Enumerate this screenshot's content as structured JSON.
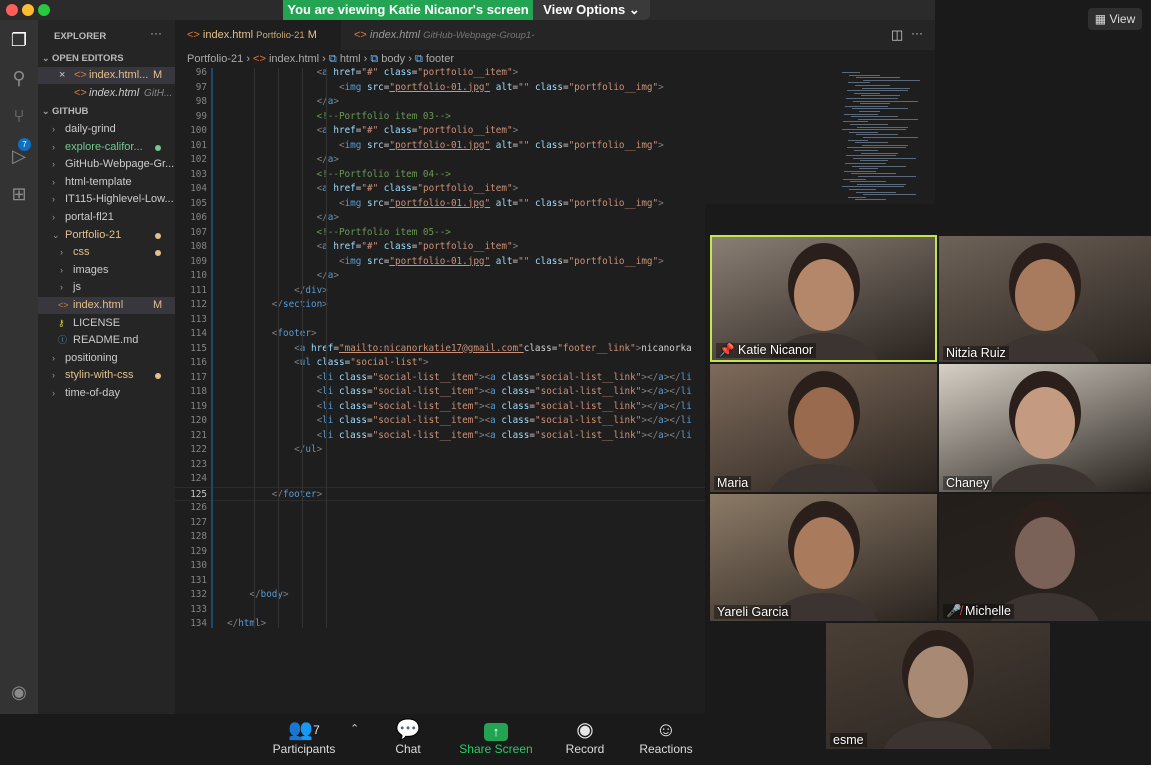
{
  "banner": {
    "sharing_text": "You are viewing Katie Nicanor's screen",
    "view_options": "View Options"
  },
  "view_button": "View",
  "sidebar": {
    "title": "EXPLORER",
    "open_editors": "OPEN EDITORS",
    "open_files": [
      {
        "name": "index.html...",
        "status": "M"
      },
      {
        "name": "index.html",
        "path": "GitH..."
      }
    ],
    "workspace": "GITHUB",
    "tree": [
      {
        "name": "daily-grind",
        "indent": 1,
        "type": "folder"
      },
      {
        "name": "explore-califor...",
        "indent": 1,
        "type": "folder",
        "color": "#73c991"
      },
      {
        "name": "GitHub-Webpage-Gr...",
        "indent": 1,
        "type": "folder"
      },
      {
        "name": "html-template",
        "indent": 1,
        "type": "folder"
      },
      {
        "name": "IT115-Highlevel-Low...",
        "indent": 1,
        "type": "folder"
      },
      {
        "name": "portal-fl21",
        "indent": 1,
        "type": "folder"
      },
      {
        "name": "Portfolio-21",
        "indent": 1,
        "type": "folder-open",
        "color": "#e2c08d"
      },
      {
        "name": "css",
        "indent": 2,
        "type": "folder",
        "color": "#e2c08d"
      },
      {
        "name": "images",
        "indent": 2,
        "type": "folder"
      },
      {
        "name": "js",
        "indent": 2,
        "type": "folder"
      },
      {
        "name": "index.html",
        "indent": 2,
        "type": "file",
        "status": "M",
        "color": "#e2c08d"
      },
      {
        "name": "LICENSE",
        "indent": 2,
        "type": "file"
      },
      {
        "name": "README.md",
        "indent": 2,
        "type": "file"
      },
      {
        "name": "positioning",
        "indent": 1,
        "type": "folder"
      },
      {
        "name": "stylin-with-css",
        "indent": 1,
        "type": "folder",
        "color": "#e2c08d"
      },
      {
        "name": "time-of-day",
        "indent": 1,
        "type": "folder"
      }
    ]
  },
  "tabs": [
    {
      "label": "index.html",
      "detail": "Portfolio-21",
      "status": "M"
    },
    {
      "label": "index.html",
      "detail": "GitHub-Webpage-Group1-"
    }
  ],
  "breadcrumb": [
    "Portfolio-21",
    "index.html",
    "html",
    "body",
    "footer"
  ],
  "code": [
    {
      "n": "96",
      "t": "                <a href=\"#\" class=\"portfolio__item\">"
    },
    {
      "n": "97",
      "t": "                    <img src=\"portfolio-01.jpg\" alt=\"\" class=\"portfolio__img\">"
    },
    {
      "n": "98",
      "t": "                </a>"
    },
    {
      "n": "99",
      "t": "                <!--Portfolio item 03-->"
    },
    {
      "n": "100",
      "t": "                <a href=\"#\" class=\"portfolio__item\">"
    },
    {
      "n": "101",
      "t": "                    <img src=\"portfolio-01.jpg\" alt=\"\" class=\"portfolio__img\">"
    },
    {
      "n": "102",
      "t": "                </a>"
    },
    {
      "n": "103",
      "t": "                <!--Portfolio item 04-->"
    },
    {
      "n": "104",
      "t": "                <a href=\"#\" class=\"portfolio__item\">"
    },
    {
      "n": "105",
      "t": "                    <img src=\"portfolio-01.jpg\" alt=\"\" class=\"portfolio__img\">"
    },
    {
      "n": "106",
      "t": "                </a>"
    },
    {
      "n": "107",
      "t": "                <!--Portfolio item 05-->"
    },
    {
      "n": "108",
      "t": "                <a href=\"#\" class=\"portfolio__item\">"
    },
    {
      "n": "109",
      "t": "                    <img src=\"portfolio-01.jpg\" alt=\"\" class=\"portfolio__img\">"
    },
    {
      "n": "110",
      "t": "                </a>"
    },
    {
      "n": "111",
      "t": "            </div>"
    },
    {
      "n": "112",
      "t": "        </section>"
    },
    {
      "n": "113",
      "t": ""
    },
    {
      "n": "114",
      "t": "        <footer>"
    },
    {
      "n": "115",
      "t": "            <a href=\"mailto:nicanorkatie17@gmail.com\"class=\"footer__link\">nicanorka"
    },
    {
      "n": "116",
      "t": "            <ul class=\"social-list\">"
    },
    {
      "n": "117",
      "t": "                <li class=\"social-list__item\"><a class=\"social-list__link\"></a></li"
    },
    {
      "n": "118",
      "t": "                <li class=\"social-list__item\"><a class=\"social-list__link\"></a></li"
    },
    {
      "n": "119",
      "t": "                <li class=\"social-list__item\"><a class=\"social-list__link\"></a></li"
    },
    {
      "n": "120",
      "t": "                <li class=\"social-list__item\"><a class=\"social-list__link\"></a></li"
    },
    {
      "n": "121",
      "t": "                <li class=\"social-list__item\"><a class=\"social-list__link\"></a></li"
    },
    {
      "n": "122",
      "t": "            </ul>"
    },
    {
      "n": "123",
      "t": ""
    },
    {
      "n": "124",
      "t": ""
    },
    {
      "n": "125",
      "t": "        </footer>"
    },
    {
      "n": "126",
      "t": ""
    },
    {
      "n": "127",
      "t": ""
    },
    {
      "n": "128",
      "t": ""
    },
    {
      "n": "129",
      "t": ""
    },
    {
      "n": "130",
      "t": ""
    },
    {
      "n": "131",
      "t": ""
    },
    {
      "n": "132",
      "t": "    </body>"
    },
    {
      "n": "133",
      "t": ""
    },
    {
      "n": "134",
      "t": "</html>"
    }
  ],
  "participants": [
    {
      "name": "Katie Nicanor",
      "active": true,
      "pinned": true,
      "bg": "#8a7e74",
      "skin": "#b5876a"
    },
    {
      "name": "Nitzia Ruiz",
      "bg": "#6e6258",
      "skin": "#a87a5e"
    },
    {
      "name": "Maria",
      "bg": "#7e6a5a",
      "skin": "#9a6a4e"
    },
    {
      "name": "Chaney",
      "bg": "#d6d0c6",
      "skin": "#c49a80"
    },
    {
      "name": "Yareli Garcia",
      "bg": "#8c7a66",
      "skin": "#a97a5c"
    },
    {
      "name": "Michelle",
      "muted": true,
      "bg": "#241e1a",
      "skin": "#7a6258"
    },
    {
      "name": "esme",
      "bg": "#4a3f36",
      "skin": "#a88a74"
    }
  ],
  "toolbar": {
    "participants_label": "Participants",
    "participants_count": "7",
    "chat_label": "Chat",
    "share_label": "Share Screen",
    "record_label": "Record",
    "reactions_label": "Reactions"
  },
  "colors": {
    "accent_green": "#23a453",
    "vscode_blue": "#0e70c0",
    "active_speaker": "#c3e64b"
  }
}
